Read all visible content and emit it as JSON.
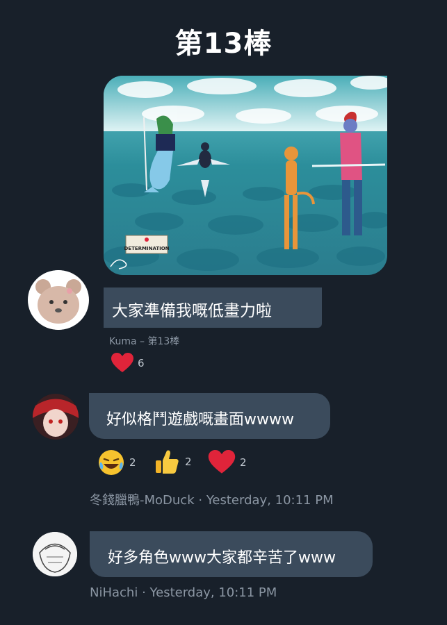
{
  "page": {
    "title": "第13棒"
  },
  "post": {
    "image": {
      "envelope_text": "DETERMINATION"
    },
    "caption": "大家準備我嘅低畫力啦",
    "author_line": "Kuma – 第13棒",
    "reactions": [
      {
        "icon": "heart-icon",
        "count": "6"
      }
    ]
  },
  "comments": [
    {
      "text": "好似格鬥遊戲嘅畫面wwww",
      "reactions": [
        {
          "icon": "laughing-face-icon",
          "count": "2"
        },
        {
          "icon": "thumbs-up-icon",
          "count": "2"
        },
        {
          "icon": "heart-icon",
          "count": "2"
        }
      ],
      "author": "冬錢臘鴨-MoDuck",
      "time": "Yesterday, 10:11 PM"
    },
    {
      "text": "好多角色www大家都辛苦了www",
      "author": "NiHachi",
      "time": "Yesterday, 10:11 PM"
    }
  ],
  "colors": {
    "background": "#18202a",
    "bubble": "#3b4b5c",
    "heart": "#e0243a",
    "meta": "#8b96a3"
  }
}
